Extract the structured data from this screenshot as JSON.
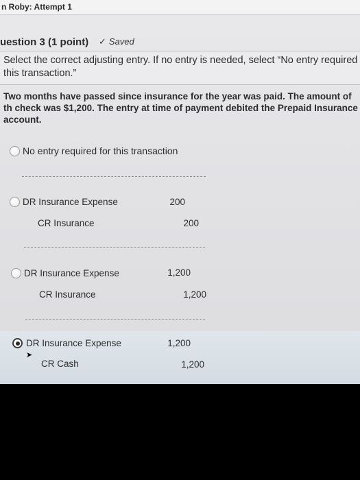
{
  "header": {
    "attempt_title": "n Roby: Attempt 1"
  },
  "question": {
    "title": "uestion 3",
    "points": "(1 point)",
    "saved_check": "✓",
    "saved_label": "Saved",
    "prompt": "Select the correct adjusting entry. If no entry is needed, select “No entry required this transaction.”",
    "scenario": "Two months have passed since insurance for the year was paid. The amount of th check was $1,200. The entry at time of payment debited the Prepaid Insurance account."
  },
  "options": [
    {
      "label": "No entry required for this transaction",
      "selected": false
    },
    {
      "line1": "DR Insurance Expense",
      "amount1": "200",
      "line2": "CR Insurance",
      "amount2": "200",
      "selected": false
    },
    {
      "line1": "DR Insurance Expense",
      "amount1": "1,200",
      "line2": "CR Insurance",
      "amount2": "1,200",
      "selected": false
    },
    {
      "line1": "DR Insurance Expense",
      "amount1": "1,200",
      "line2": "CR Cash",
      "amount2": "1,200",
      "selected": true
    }
  ]
}
